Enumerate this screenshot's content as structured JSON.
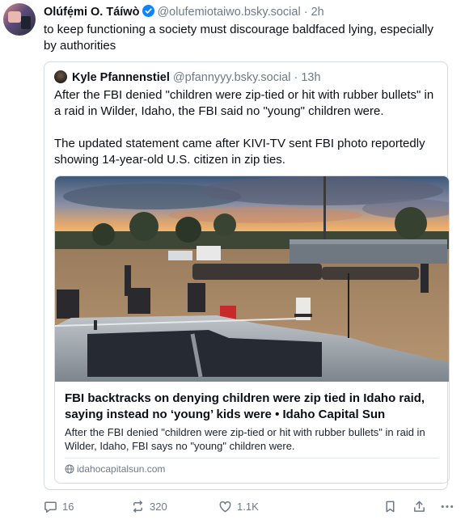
{
  "post": {
    "author_name": "Olúfẹ́mi O. Táíwò",
    "handle": "@olufemiotaiwo.bsky.social",
    "separator": "·",
    "time": "2h",
    "text": "to keep functioning a society must discourage baldfaced lying, especially by authorities"
  },
  "quote": {
    "author_name": "Kyle Pfannenstiel",
    "handle": "@pfannyyy.bsky.social",
    "separator": "·",
    "time": "13h",
    "paragraph1": "After the FBI denied \"children were zip-tied or hit with rubber bullets\" in a raid in Wilder, Idaho, the FBI said no \"young\" children were.",
    "paragraph2": "The updated statement  came after KIVI-TV sent FBI photo reportedly showing 14-year-old U.S. citizen in zip ties.",
    "card": {
      "title": "FBI backtracks on denying children were zip tied in Idaho raid, saying instead no ‘young’ kids were • Idaho Capital Sun",
      "description": "After the FBI denied \"children were zip-tied or hit with rubber bullets\" in raid in Wilder, Idaho, FBI says no \"young\" children were.",
      "domain": "idahocapitalsun.com"
    }
  },
  "actions": {
    "replies": "16",
    "reposts": "320",
    "likes": "1.1K"
  },
  "colors": {
    "accent": "#1083fe",
    "muted": "#6f7a86",
    "border": "#d4dbe2"
  },
  "icons": [
    "verified-badge-icon",
    "reply-icon",
    "repost-icon",
    "like-icon",
    "bookmark-icon",
    "share-icon",
    "more-icon",
    "globe-icon"
  ]
}
